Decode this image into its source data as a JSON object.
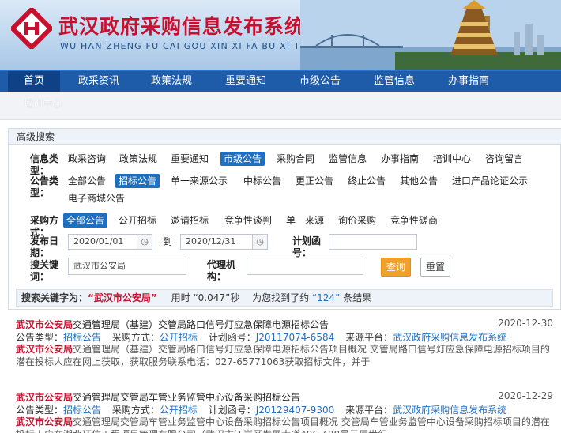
{
  "header": {
    "title": "武汉政府采购信息发布系统",
    "subtitle": "WU HAN ZHENG FU CAI GOU XIN XI FA BU XI TONG"
  },
  "nav": {
    "items": [
      "首页",
      "政采资讯",
      "政策法规",
      "重要通知",
      "市级公告",
      "监管信息",
      "办事指南"
    ],
    "active_index": 0,
    "sub_item": "培训中心"
  },
  "search": {
    "panel_title": "高级搜索",
    "info_type_label": "信息类型：",
    "info_types": [
      "政采咨询",
      "政策法规",
      "重要通知",
      "市级公告",
      "采购合同",
      "监管信息",
      "办事指南",
      "培训中心",
      "咨询留言"
    ],
    "info_type_selected": 3,
    "notice_type_label": "公告类型：",
    "notice_types": [
      "全部公告",
      "招标公告",
      "单一来源公示",
      "中标公告",
      "更正公告",
      "终止公告",
      "其他公告",
      "进口产品论证公示",
      "电子商城公告"
    ],
    "notice_type_selected": 1,
    "method_label": "采购方式：",
    "methods": [
      "全部公告",
      "公开招标",
      "邀请招标",
      "竞争性谈判",
      "单一来源",
      "询价采购",
      "竞争性磋商"
    ],
    "method_selected": 0,
    "date_label": "发布日期：",
    "date_from": "2020/01/01",
    "date_to_label": "到",
    "date_to": "2020/12/31",
    "plan_label": "计划函号：",
    "plan_value": "",
    "keyword_label": "搜关键词：",
    "keyword_value": "武汉市公安局",
    "agency_label": "代理机构：",
    "agency_value": "",
    "query_button": "查询",
    "reset_button": "重置"
  },
  "summary": {
    "prefix": "搜索关键字为：",
    "keyword": "“武汉市公安局”",
    "time_text": "用时 “0.047”秒",
    "count_prefix": "为您找到了约",
    "count": "“124”",
    "count_suffix": "条结果"
  },
  "results": [
    {
      "title_hl": "武汉市公安局",
      "title_rest": "交通管理局（基建）交管局路口信号灯应急保障电源招标公告",
      "date": "2020-12-30",
      "type_label": "公告类型：",
      "type": "招标公告",
      "method_label": "采购方式：",
      "method": "公开招标",
      "plan_label": "计划函号：",
      "plan": "J20117074-6584",
      "source_label": "来源平台：",
      "source": "武汉政府采购信息发布系统",
      "desc_hl": "武汉市公安局",
      "desc": "交通管理局（基建）交管局路口信号灯应急保障电源招标公告项目概况 交管局路口信号灯应急保障电源招标项目的潜在投标人应在网上获取，获取服务联系电话：027-65771063获取招标文件，并于"
    },
    {
      "title_hl": "武汉市公安局",
      "title_rest": "交通管理局交管局车管业务监管中心设备采购招标公告",
      "date": "2020-12-29",
      "type_label": "公告类型：",
      "type": "招标公告",
      "method_label": "采购方式：",
      "method": "公开招标",
      "plan_label": "计划函号：",
      "plan": "J20129407-9300",
      "source_label": "来源平台：",
      "source": "武汉政府采购信息发布系统",
      "desc_hl": "武汉市公安局",
      "desc": "交通管理局交管局车管业务监管中心设备采购招标公告项目概况 交管局车管业务监管中心设备采购招标项目的潜在投标人应在湖北环信工程项目管理有限公司（武汉市江岸区发展大道486-488号元辰世纪"
    }
  ],
  "colors": {
    "nav_bg": "#1e5ba8",
    "nav_active": "#0f4186",
    "highlight": "#c8102e",
    "selected_option": "#1f6fc1",
    "query_button": "#f0a12b"
  }
}
